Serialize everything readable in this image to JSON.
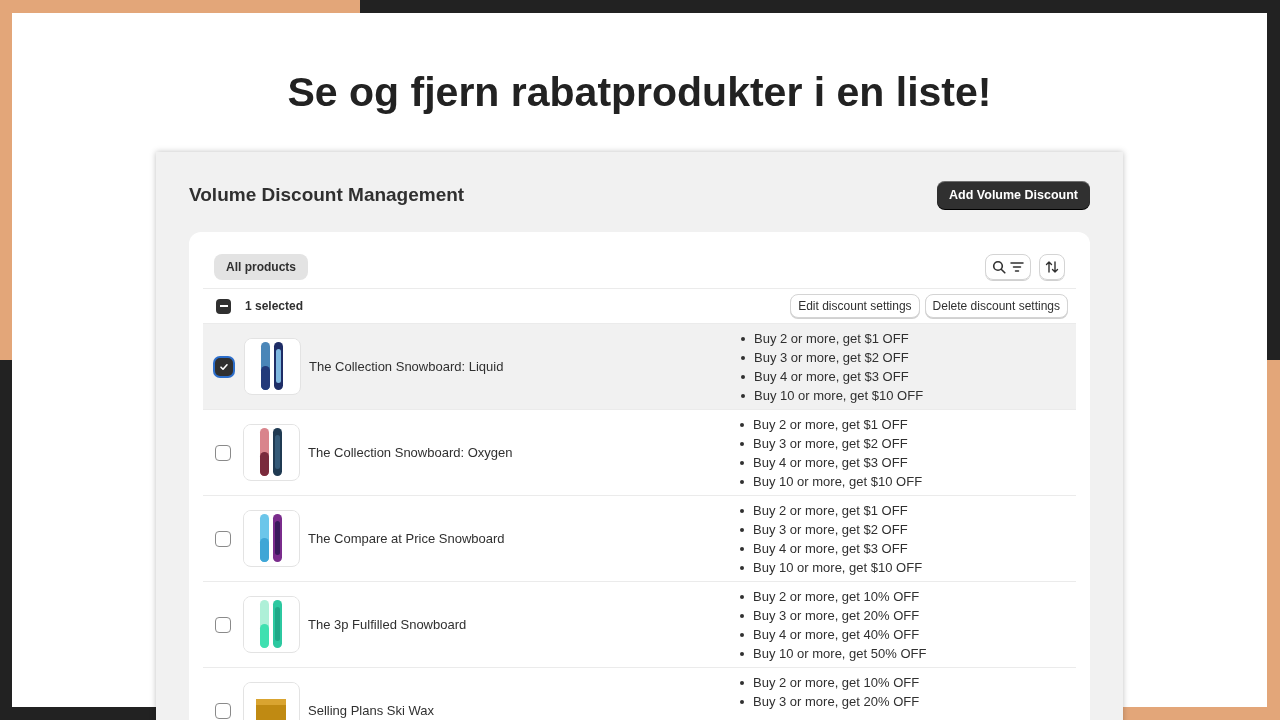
{
  "headline": "Se og fjern rabatprodukter i en liste!",
  "page": {
    "title": "Volume Discount Management",
    "primary_button": "Add Volume Discount"
  },
  "tabs": [
    {
      "label": "All products",
      "selected": true
    }
  ],
  "bulk_bar": {
    "indeterminate": true,
    "label": "1 selected",
    "actions": [
      "Edit discount settings",
      "Delete discount settings"
    ]
  },
  "rows": [
    {
      "name": "The Collection Snowboard: Liquid",
      "selected": true,
      "discounts": [
        "Buy 2 or more, get $1 OFF",
        "Buy 3 or more, get $2 OFF",
        "Buy 4 or more, get $3 OFF",
        "Buy 10 or more, get $10 OFF"
      ]
    },
    {
      "name": "The Collection Snowboard: Oxygen",
      "selected": false,
      "discounts": [
        "Buy 2 or more, get $1 OFF",
        "Buy 3 or more, get $2 OFF",
        "Buy 4 or more, get $3 OFF",
        "Buy 10 or more, get $10 OFF"
      ]
    },
    {
      "name": "The Compare at Price Snowboard",
      "selected": false,
      "discounts": [
        "Buy 2 or more, get $1 OFF",
        "Buy 3 or more, get $2 OFF",
        "Buy 4 or more, get $3 OFF",
        "Buy 10 or more, get $10 OFF"
      ]
    },
    {
      "name": "The 3p Fulfilled Snowboard",
      "selected": false,
      "discounts": [
        "Buy 2 or more, get 10% OFF",
        "Buy 3 or more, get 20% OFF",
        "Buy 4 or more, get 40% OFF",
        "Buy 10 or more, get 50% OFF"
      ]
    },
    {
      "name": "Selling Plans Ski Wax",
      "selected": false,
      "discounts": [
        "Buy 2 or more, get 10% OFF",
        "Buy 3 or more, get 20% OFF"
      ]
    }
  ]
}
